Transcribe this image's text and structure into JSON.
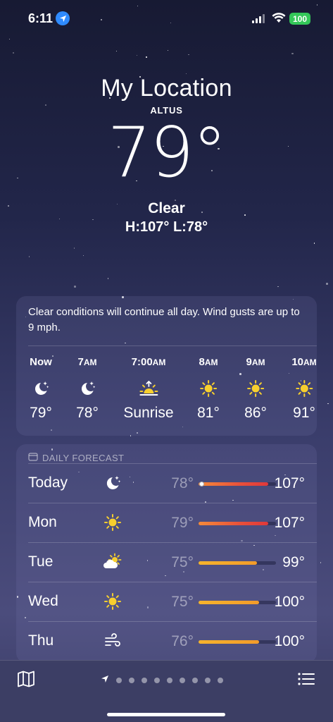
{
  "status_bar": {
    "time": "6:11",
    "battery": "100"
  },
  "header": {
    "title": "My Location",
    "subtitle": "ALTUS",
    "temperature": "79°",
    "condition": "Clear",
    "hilo": "H:107°  L:78°"
  },
  "hourly": {
    "summary": "Clear conditions will continue all day. Wind gusts are up to 9 mph.",
    "items": [
      {
        "time": "Now",
        "suffix": "",
        "icon": "moon-stars-icon",
        "temp": "79°"
      },
      {
        "time": "7",
        "suffix": "AM",
        "icon": "moon-stars-icon",
        "temp": "78°"
      },
      {
        "time": "7:00",
        "suffix": "AM",
        "icon": "sunrise-icon",
        "temp": "Sunrise"
      },
      {
        "time": "8",
        "suffix": "AM",
        "icon": "sun-icon",
        "temp": "81°"
      },
      {
        "time": "9",
        "suffix": "AM",
        "icon": "sun-icon",
        "temp": "86°"
      },
      {
        "time": "10",
        "suffix": "AM",
        "icon": "sun-icon",
        "temp": "91°"
      }
    ]
  },
  "daily": {
    "header": "DAILY FORECAST",
    "days": [
      {
        "name": "Today",
        "icon": "moon-stars-icon",
        "low": "78°",
        "high": "107°",
        "bar_start": 0.0,
        "bar_end": 0.9,
        "color": "#e8503a",
        "current_pos": 0.02
      },
      {
        "name": "Mon",
        "icon": "sun-icon",
        "low": "79°",
        "high": "107°",
        "bar_start": 0.0,
        "bar_end": 0.9,
        "color": "#e8503a"
      },
      {
        "name": "Tue",
        "icon": "partly-cloudy-icon",
        "low": "75°",
        "high": "99°",
        "bar_start": 0.0,
        "bar_end": 0.75,
        "color": "#f2a52a"
      },
      {
        "name": "Wed",
        "icon": "sun-icon",
        "low": "75°",
        "high": "100°",
        "bar_start": 0.0,
        "bar_end": 0.78,
        "color": "#f2a52a"
      },
      {
        "name": "Thu",
        "icon": "wind-icon",
        "low": "76°",
        "high": "100°",
        "bar_start": 0.0,
        "bar_end": 0.78,
        "color": "#f2a52a"
      }
    ]
  },
  "tabbar": {
    "page_count": 9
  }
}
